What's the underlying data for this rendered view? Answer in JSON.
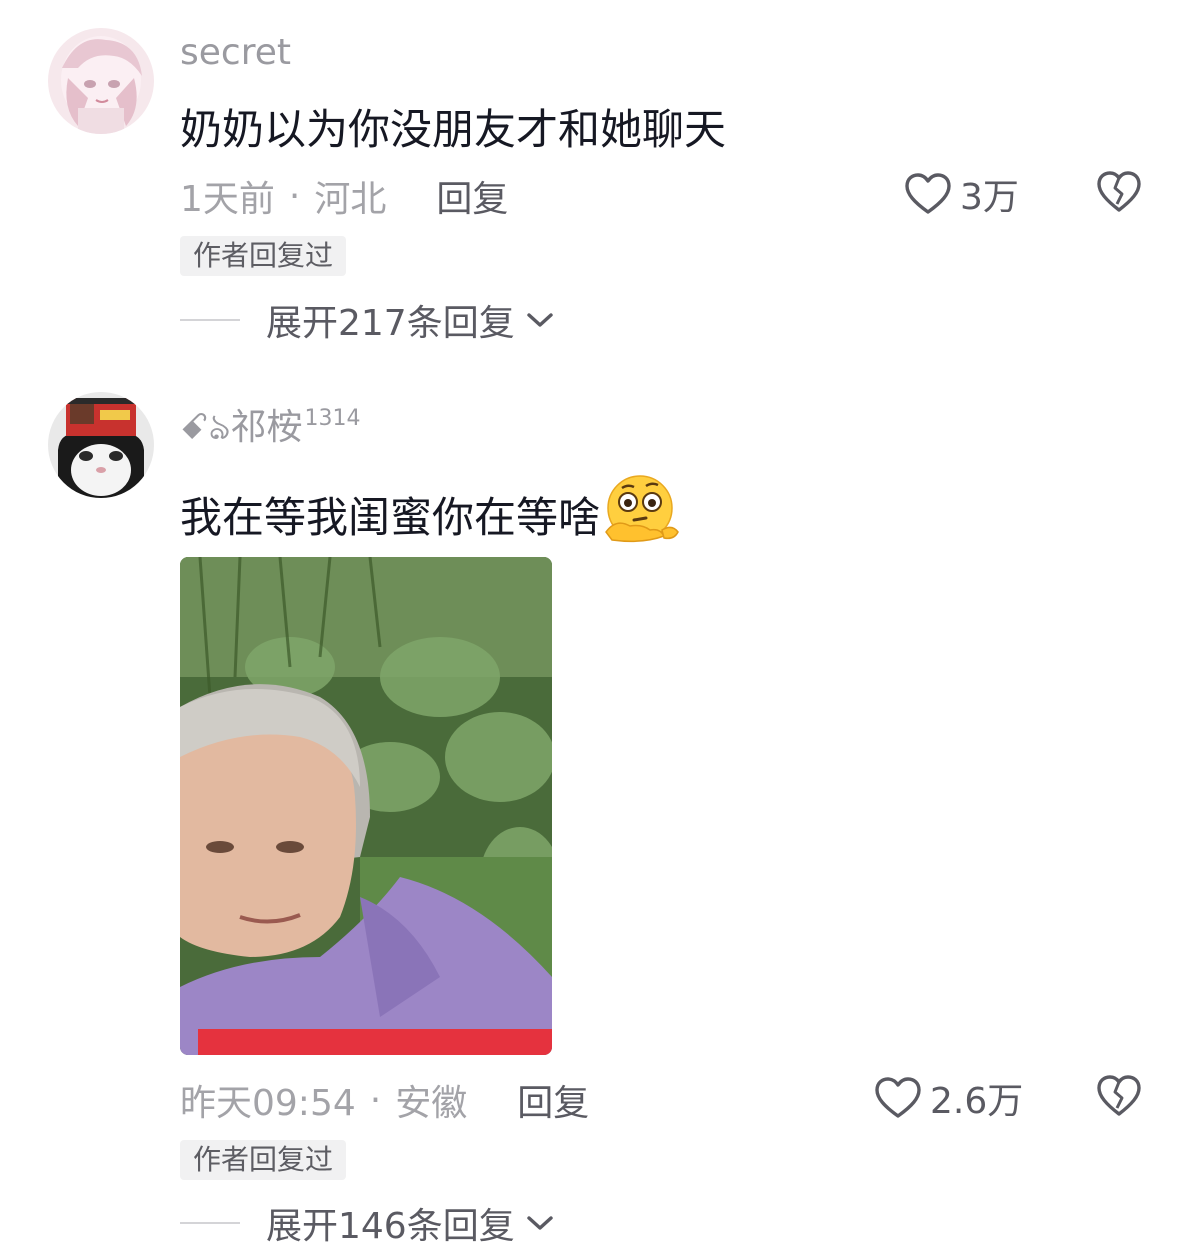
{
  "comments": [
    {
      "username": "secret",
      "text": "奶奶以为你没朋友才和她聊天",
      "time": "1天前",
      "location": "河北",
      "reply_label": "回复",
      "likes": "3万",
      "author_tag": "作者回复过",
      "expand_label": "展开217条回复",
      "avatar_icon": "anime-girl-avatar"
    },
    {
      "username": "ꗃঌ祁桉",
      "username_sup": "1314",
      "text": "我在等我闺蜜你在等啥",
      "emoji_icon": "thinking-flushed-emoji",
      "time": "昨天09:54",
      "location": "安徽",
      "reply_label": "回复",
      "likes": "2.6万",
      "author_tag": "作者回复过",
      "expand_label": "展开146条回复",
      "avatar_icon": "cat-with-noodle-pack-avatar",
      "image_icon": "elderly-woman-photo"
    }
  ],
  "colors": {
    "text_primary": "#161823",
    "text_secondary": "#a3a3a8",
    "accent_bar": "#e5323e"
  }
}
